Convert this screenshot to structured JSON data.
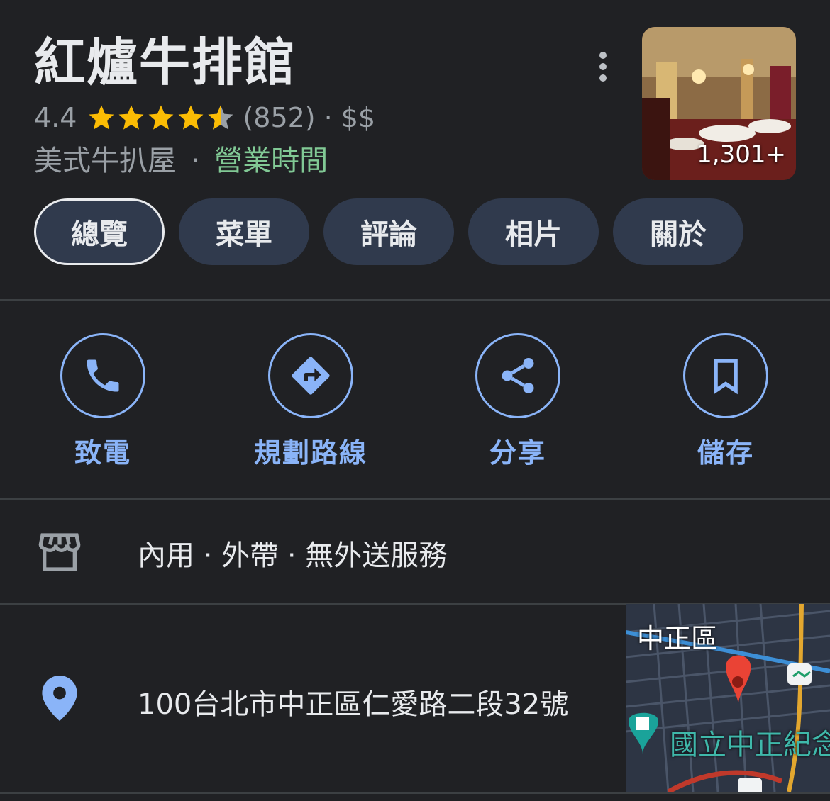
{
  "place": {
    "name": "紅爐牛排館",
    "rating": "4.4",
    "stars": 4.4,
    "reviews": "(852)",
    "dot": "·",
    "price": "$$",
    "category": "美式牛扒屋",
    "hours": "營業時間",
    "photo_count": "1,301+"
  },
  "tabs": [
    {
      "label": "總覽",
      "active": true
    },
    {
      "label": "菜單"
    },
    {
      "label": "評論"
    },
    {
      "label": "相片"
    },
    {
      "label": "關於"
    }
  ],
  "actions": [
    {
      "label": "致電",
      "icon": "phone-icon"
    },
    {
      "label": "規劃路線",
      "icon": "directions-icon"
    },
    {
      "label": "分享",
      "icon": "share-icon"
    },
    {
      "label": "儲存",
      "icon": "bookmark-icon"
    }
  ],
  "services": {
    "text": "內用 · 外帶 · 無外送服務",
    "icon": "storefront-icon"
  },
  "address": {
    "text": "100台北市中正區仁愛路二段32號",
    "icon": "location-pin-icon"
  },
  "map": {
    "district": "中正區",
    "landmark": "國立中正紀念"
  },
  "colors": {
    "accent": "#8ab4f8",
    "open": "#81c995",
    "background": "#202124",
    "tab_bg": "#303a4d",
    "star": "#fbbc04"
  }
}
